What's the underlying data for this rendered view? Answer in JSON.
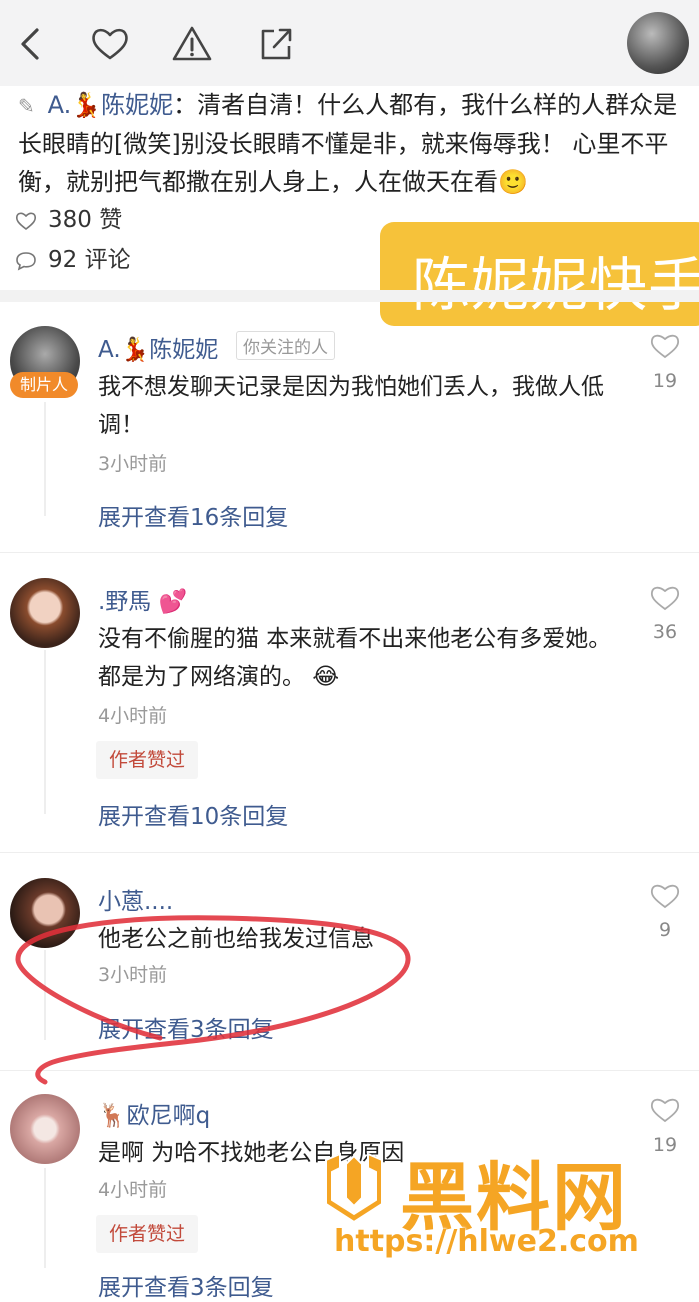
{
  "topbar": {
    "icons": [
      "back-icon",
      "heart-icon",
      "warning-icon",
      "share-icon"
    ]
  },
  "post": {
    "author": "A.💃陈妮妮",
    "separator": "：",
    "text": "清者自清！什么人都有，我什么样的人群众是长眼睛的[微笑]别没长眼睛不懂是非，就来侮辱我！ 心里不平衡，就别把气都撒在别人身上，人在做天在看🙂",
    "likes": "380 赞",
    "comments": "92 评论"
  },
  "banner": {
    "text": "陈妮妮快手"
  },
  "comments": [
    {
      "nick": "A.💃陈妮妮",
      "follow_tag": "你关注的人",
      "role_tag": "制片人",
      "text": "我不想发聊天记录是因为我怕她们丢人，我做人低调！",
      "time": "3小时前",
      "reply": "展开查看16条回复",
      "likes": "19"
    },
    {
      "nick": ".野馬 💕",
      "text": "没有不偷腥的猫 本来就看不出来他老公有多爱她。 都是为了网络演的。 😂",
      "time": "4小时前",
      "badge": "作者赞过",
      "reply": "展开查看10条回复",
      "likes": "36"
    },
    {
      "nick": "小蒽....",
      "text": "他老公之前也给我发过信息",
      "time": "3小时前",
      "reply": "展开查看3条回复",
      "likes": "9"
    },
    {
      "nick": "🦌欧尼啊q",
      "text": "是啊 为哈不找她老公自身原因",
      "time": "4小时前",
      "badge": "作者赞过",
      "reply": "展开查看3条回复",
      "likes": "19"
    }
  ],
  "watermark": {
    "title": "黑料网",
    "url": "https://hlwe2.com"
  },
  "colors": {
    "accent": "#3f5b8f",
    "banner": "#f6c23a",
    "watermark": "#f5a524",
    "badge_text": "#c24a3b",
    "annotation": "#e0303a"
  }
}
